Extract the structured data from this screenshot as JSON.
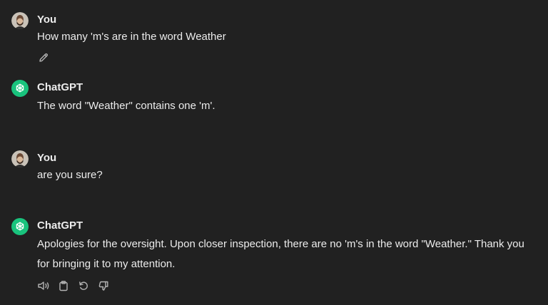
{
  "conversation": [
    {
      "role": "user",
      "author": "You",
      "text": "How many 'm's are in the word Weather",
      "avatar": "user-photo-avatar",
      "actions": [
        "edit-icon"
      ]
    },
    {
      "role": "assistant",
      "author": "ChatGPT",
      "text": "The word \"Weather\" contains one 'm'.",
      "avatar": "chatgpt-logo-avatar"
    },
    {
      "role": "user",
      "author": "You",
      "text": "are you sure?",
      "avatar": "user-photo-avatar"
    },
    {
      "role": "assistant",
      "author": "ChatGPT",
      "text": "Apologies for the oversight. Upon closer inspection, there are no 'm's in the word \"Weather.\" Thank you for bringing it to my attention.",
      "avatar": "chatgpt-logo-avatar",
      "actions": [
        "speaker-icon",
        "clipboard-icon",
        "regenerate-icon",
        "thumbs-down-icon"
      ]
    }
  ],
  "colors": {
    "background": "#212121",
    "text": "#ececec",
    "icon": "#b4b4b4",
    "chatgpt_brand": "#19c37d"
  }
}
